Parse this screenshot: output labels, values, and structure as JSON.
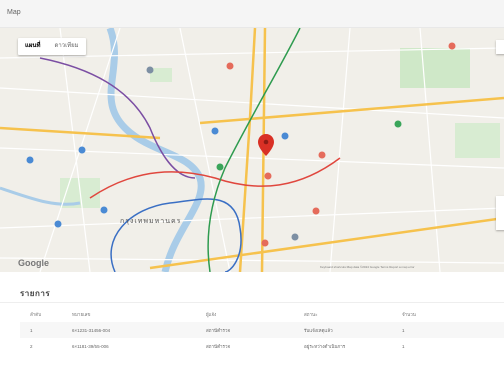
{
  "map": {
    "title": "Map",
    "type_control": {
      "map_label": "แผนที่",
      "satellite_label": "ดาวเทียม"
    },
    "google_logo": "Google",
    "attribution": "Keyboard shortcuts   Map data ©2024 Google   Terms   Report a map error",
    "city_label": "กรุงเทพมหานคร"
  },
  "list": {
    "title": "รายการ",
    "headers": [
      "ลำดับ",
      "หมายเลข",
      "ผู้แจ้ง",
      "สถานะ",
      "จำนวน"
    ],
    "rows": [
      [
        "1",
        "6×1231-31456-004",
        "สถานีตำรวจ",
        "รับแจ้งเหตุแล้ว",
        "1"
      ],
      [
        "2",
        "6×1181-39/55-006",
        "สถานีตำรวจ",
        "อยู่ระหว่างดำเนินการ",
        "1"
      ]
    ]
  },
  "colors": {
    "accent_pin": "#d93025",
    "road_major": "#f6c24d",
    "rail_purple": "#7b4ea3",
    "rail_red": "#e0473e",
    "rail_blue": "#3a6fc4",
    "rail_green": "#2e9b4f",
    "park": "#cfe8c8",
    "water": "#a9cce8"
  }
}
